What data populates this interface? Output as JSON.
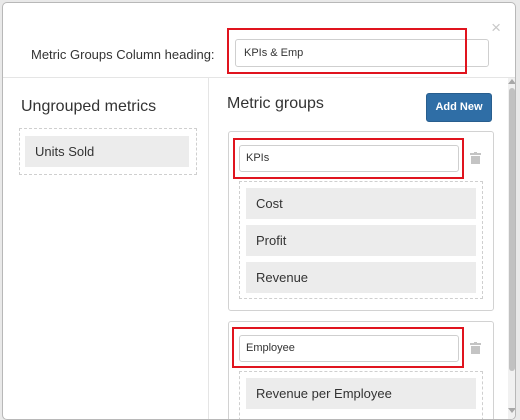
{
  "header": {
    "heading_label": "Metric Groups Column heading:",
    "heading_value": "KPIs & Emp",
    "close_glyph": "×"
  },
  "ungrouped": {
    "title": "Ungrouped metrics",
    "items": [
      "Units Sold"
    ]
  },
  "groups_section": {
    "title": "Metric groups",
    "add_button": "Add New",
    "groups": [
      {
        "name": "KPIs",
        "metrics": [
          "Cost",
          "Profit",
          "Revenue"
        ]
      },
      {
        "name": "Employee",
        "metrics": [
          "Revenue per Employee"
        ]
      }
    ]
  },
  "colors": {
    "highlight": "#e0141e",
    "primary_button": "#2f6ea6",
    "chip_bg": "#ececec"
  },
  "icons": {
    "close": "close-icon",
    "trash": "trash-icon"
  }
}
